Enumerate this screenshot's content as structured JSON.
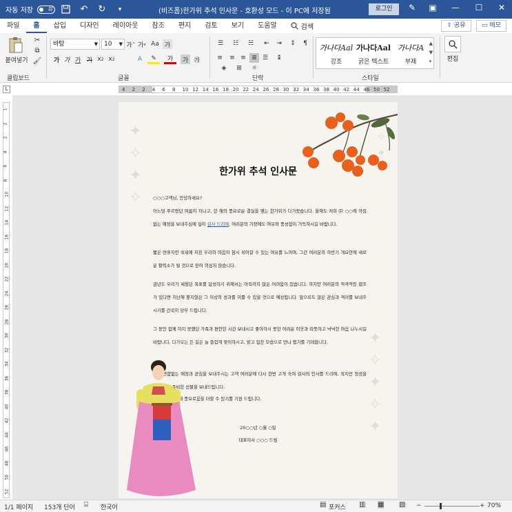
{
  "titlebar": {
    "autosave_label": "자동 저장",
    "autosave_state": "끔",
    "doc_title": "(비즈폼)한가위 추석 인사문  -  호환성 모드  -  이 PC에 저장됨",
    "login_label": "로그인"
  },
  "tabs": [
    "파일",
    "홈",
    "삽입",
    "디자인",
    "레이아웃",
    "참조",
    "편지",
    "검토",
    "보기",
    "도움말"
  ],
  "active_tab": "홈",
  "search_label": "검색",
  "share_label": "공유",
  "memo_label": "메모",
  "ribbon": {
    "clipboard": {
      "paste_label": "붙여넣기",
      "group_label": "클립보드"
    },
    "font": {
      "font_name": "바탕",
      "font_size": "10",
      "group_label": "글꼴"
    },
    "paragraph": {
      "group_label": "단락"
    },
    "styles": {
      "group_label": "스타일",
      "items": [
        {
          "sample": "가나다Aal",
          "name": "강조"
        },
        {
          "sample": "가나다Aal",
          "name": "굵은 텍스트"
        },
        {
          "sample": "가나다A",
          "name": "부제"
        }
      ]
    },
    "editing": {
      "label": "편집"
    }
  },
  "ruler_numbers": [
    "4",
    "2",
    "2",
    "4",
    "6",
    "8",
    "10",
    "12",
    "14",
    "16",
    "18",
    "20",
    "22",
    "24",
    "26",
    "28",
    "30",
    "32",
    "34",
    "36",
    "38",
    "40",
    "42",
    "44",
    "46",
    "50",
    "52"
  ],
  "vruler_numbers": [
    "1",
    "2",
    "2",
    "4",
    "6",
    "8",
    "10",
    "12",
    "14",
    "16",
    "18",
    "20",
    "22",
    "24",
    "26",
    "28",
    "30",
    "32",
    "34",
    "36",
    "38",
    "40",
    "42",
    "44",
    "46",
    "48",
    "50",
    "52"
  ],
  "document": {
    "heading": "한가위 추석 인사문",
    "paragraphs": [
      "○○○고객님, 안녕하세요?",
      "어느덧 푸르렀던 여름이 지나고, 한 해의 풍요로운 결실을 맺는 한가위가 다가왔습니다. 올해도 저희 ㈜ ○○에 아낌없는 애정을 보내주심에 깊이",
      "감사 드리며",
      ", 여러분의 가정에도 여유와 풍성함이 가득하시길 바랍니다.",
      "짧은 연휴지만 쉬워에 지친 우리의 마음이 잠시 쉬어갈 수 있는 여유를 느끼며, 그간 여러분의 하반기 개요안에 새로운 활력소가 될 것으로 믿어 의심치 않습니다.",
      "금년도 우리가 세웠던 목표를 달성하기 위해서는 아직까지 많은 어려움이 있습니다. 하지만 여러분의 적극적인 협조가 있다면 지난해 뿐지않은 그 이상의 성과를 이룰 수 있을 것으로 예상됩니다. 앞으로도 많은 관심과 격려를 보내주시기를 간곡히 당부 드립니다.",
      "그 동안 함께 하지 못했던 가족과 편안한 시간 보내시고 좋아하시 못한 어려운 이웃과 따뜻하고 넉넉한 마음 나누시길 바랍니다. 다가오는 든 길은 늘 즐겁게 맞이하시고, 밝고 힘찬 모습으로 만나 뵙기를 기대합니다.",
      "항상 변함없는 애정과 관심을 보내주시는 고객 여러분께 다시 한번 고개 숙여 감사의 인사를 드리며, 작지만 정성을 가득 담아 준비한 선물을 보내드립니다.",
      "여러분의 마음에 풍요로움을 더할 수 있기를 기원 드립니다."
    ],
    "date_line": "20○○년  ○월  ○일",
    "signature": "대표이사  ○○○  드림"
  },
  "statusbar": {
    "page": "1/1 페이지",
    "words": "153개 단어",
    "language": "한국어",
    "focus": "포커스",
    "zoom": "70%"
  },
  "colors": {
    "brand": "#2b579a",
    "persimmon": "#e8601c",
    "hanbok_skirt": "#e98ac0",
    "hanbok_top": "#e6df60"
  }
}
